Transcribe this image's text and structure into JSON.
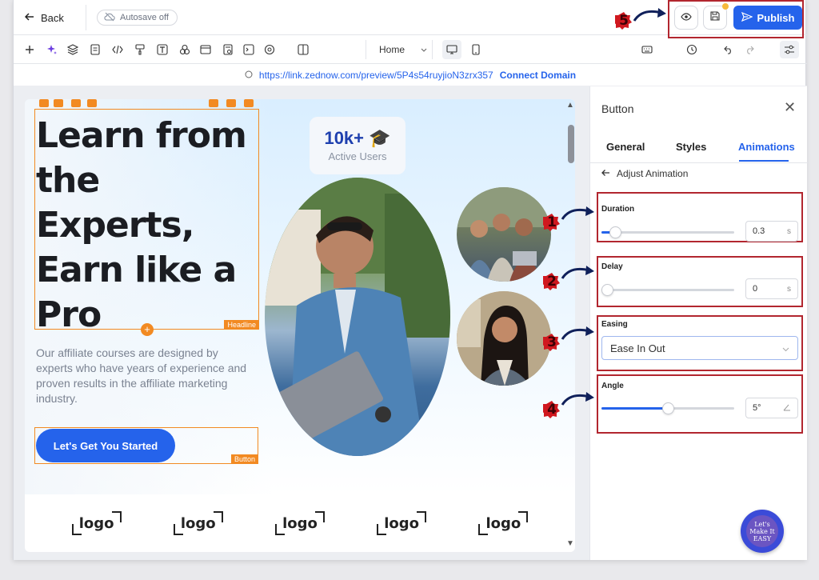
{
  "topbar": {
    "back_label": "Back",
    "autosave_label": "Autosave off",
    "publish_label": "Publish"
  },
  "toolbar": {
    "page_select": "Home"
  },
  "urlbar": {
    "url": "https://link.zednow.com/preview/5P4s54ruyjioN3zrx357",
    "connect_label": "Connect Domain"
  },
  "canvas": {
    "headline": "Learn from the Experts, Earn like a Pro",
    "headline_tag": "Headline",
    "description": "Our affiliate courses are designed by experts who have years of experience and proven results in the affiliate marketing industry.",
    "cta_label": "Let's Get You Started",
    "button_tag": "Button",
    "stat_number": "10k+",
    "stat_label": "Active Users",
    "logos": [
      "logo",
      "logo",
      "logo",
      "logo",
      "logo"
    ]
  },
  "panel": {
    "title": "Button",
    "tabs": [
      "General",
      "Styles",
      "Animations"
    ],
    "active_tab": "Animations",
    "adjust_label": "Adjust Animation",
    "duration": {
      "label": "Duration",
      "value": "0.3",
      "unit": "s",
      "level": 0.1
    },
    "delay": {
      "label": "Delay",
      "value": "0",
      "unit": "s",
      "level": 0.0
    },
    "easing": {
      "label": "Easing",
      "value": "Ease In Out"
    },
    "angle": {
      "label": "Angle",
      "value": "5°",
      "level": 0.5
    }
  },
  "markers": [
    "1",
    "2",
    "3",
    "4",
    "5"
  ],
  "chat_widget": "Let's Make It EASY",
  "colors": {
    "accent": "#2563eb",
    "selection": "#f28a22",
    "annotation": "#b2262f"
  }
}
